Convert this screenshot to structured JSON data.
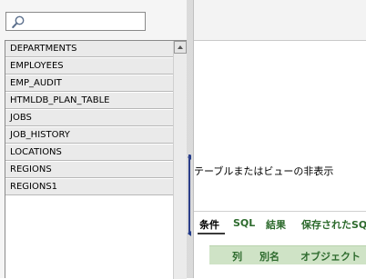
{
  "search": {
    "placeholder": "",
    "value": ""
  },
  "tables": [
    "DEPARTMENTS",
    "EMPLOYEES",
    "EMP_AUDIT",
    "HTMLDB_PLAN_TABLE",
    "JOBS",
    "JOB_HISTORY",
    "LOCATIONS",
    "REGIONS",
    "REGIONS1"
  ],
  "splitter": {
    "hide_label": "テーブルまたはビューの非表示"
  },
  "tabs": [
    {
      "label": "条件",
      "active": true
    },
    {
      "label": "SQL",
      "active": false
    },
    {
      "label": "結果",
      "active": false
    },
    {
      "label": "保存されたSQL",
      "active": false
    }
  ],
  "columns_bar": {
    "headers": [
      "列",
      "別名",
      "オブジェクト"
    ]
  },
  "colors": {
    "tab_green": "#2e6b2e",
    "header_bar_green": "#cfe3c6",
    "splitter_blue": "#2c3f8a"
  }
}
